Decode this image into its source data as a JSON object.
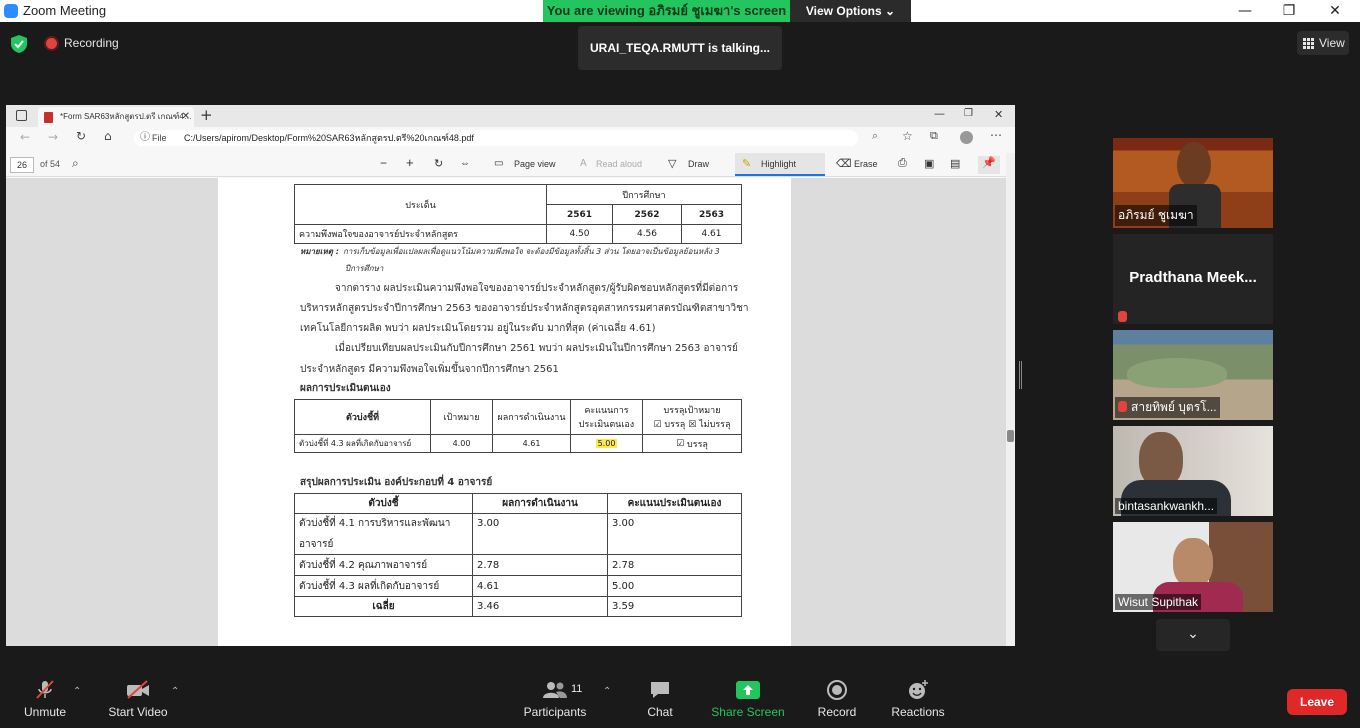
{
  "window": {
    "title": "Zoom Meeting",
    "minimize": "—",
    "maximize": "❐",
    "close": "✕"
  },
  "banner": {
    "viewing": "You are viewing อภิรมย์ ชูเมฆา's screen",
    "view_options": "View Options"
  },
  "status": {
    "recording": "Recording",
    "talking": "URAI_TEQA.RMUTT is talking...",
    "view_button": "View"
  },
  "browser": {
    "tab_title": "*Form SAR63หลักสูตรป.ตรี เกณฑ์4…",
    "file_label": "File",
    "url": "C:/Users/apirom/Desktop/Form%20SAR63หลักสูตรป.ตรี%20เกณฑ์48.pdf",
    "page_current": "26",
    "page_total": "of 54",
    "toolbar": {
      "page_view": "Page view",
      "read_aloud": "Read aloud",
      "draw": "Draw",
      "highlight": "Highlight",
      "erase": "Erase"
    }
  },
  "pdf": {
    "table1": {
      "h_topic": "ประเด็น",
      "h_year": "ปีการศึกษา",
      "years": [
        "2561",
        "2562",
        "2563"
      ],
      "row_label": "ความพึงพอใจของอาจารย์ประจำหลักสูตร",
      "values": [
        "4.50",
        "4.56",
        "4.61"
      ]
    },
    "note_label": "หมายเหตุ :",
    "note_line1": "การเก็บข้อมูลเพื่อแปลผลเพื่อดูแนวโน้มความพึงพอใจ จะต้องมีข้อมูลทั้งสิ้น 3 ส่วน โดยอาจเป็นข้อมูลย้อนหลัง 3",
    "note_line2": "ปีการศึกษา",
    "para1_l1": "จากตาราง ผลประเมินความพึงพอใจของอาจารย์ประจำหลักสูตร/ผู้รับผิดชอบหลักสูตรที่มีต่อการ",
    "para1_l2": "บริหารหลักสูตรประจำปีการศึกษา 2563 ของอาจารย์ประจำหลักสูตรอุตสาหกรรมศาสตรบัณฑิตสาขาวิชา",
    "para1_l3": "เทคโนโลยีการผลิต พบว่า ผลประเมินโดยรวม อยู่ในระดับ มากที่สุด (ค่าเฉลี่ย 4.61)",
    "para2_l1": "เมื่อเปรียบเทียบผลประเมินกับปีการศึกษา 2561 พบว่า ผลประเมินในปีการศึกษา 2563 อาจารย์",
    "para2_l2": "ประจำหลักสูตร มีความพึงพอใจเพิ่มขึ้นจากปีการศึกษา 2561",
    "self_eval_heading": "ผลการประเมินตนเอง",
    "table2": {
      "h_indicator": "ตัวบ่งชี้ที่",
      "h_target": "เป้าหมาย",
      "h_result": "ผลการดำเนินงาน",
      "h_score_l1": "คะแนนการ",
      "h_score_l2": "ประเมินตนเอง",
      "h_achieve": "บรรลุเป้าหมาย",
      "h_yes": "บรรลุ",
      "h_no": "ไม่บรรลุ",
      "row_indicator": "ตัวบ่งชี้ที่ 4.3 ผลที่เกิดกับอาจารย์",
      "row_target": "4.00",
      "row_result": "4.61",
      "row_score": "5.00",
      "row_achieve": "บรรลุ"
    },
    "summary_heading": "สรุปผลการประเมิน องค์ประกอบที่ 4 อาจารย์",
    "table3": {
      "h_indicator": "ตัวบ่งชี้",
      "h_result": "ผลการดำเนินงาน",
      "h_score": "คะแนนประเมินตนเอง",
      "r1_l1": "ตัวบ่งชี้ที่ 4.1 การบริหารและพัฒนา",
      "r1_l2": "อาจารย์",
      "r1_result": "3.00",
      "r1_score": "3.00",
      "r2_label": "ตัวบ่งชี้ที่ 4.2 คุณภาพอาจารย์",
      "r2_result": "2.78",
      "r2_score": "2.78",
      "r3_label": "ตัวบ่งชี้ที่ 4.3 ผลที่เกิดกับอาจารย์",
      "r3_result": "4.61",
      "r3_score": "5.00",
      "avg_label": "เฉลี่ย",
      "avg_result": "3.46",
      "avg_score": "3.59"
    }
  },
  "participants_panel": [
    {
      "name": "อภิรมย์ ชูเมฆา"
    },
    {
      "name": "Pradthana Meek..."
    },
    {
      "name": "สายทิพย์ บุตรโ..."
    },
    {
      "name": "bintasankwankh..."
    },
    {
      "name": "Wisut Supithak"
    }
  ],
  "toolbar": {
    "unmute": "Unmute",
    "start_video": "Start Video",
    "participants": "Participants",
    "participants_count": "11",
    "chat": "Chat",
    "share_screen": "Share Screen",
    "record": "Record",
    "reactions": "Reactions",
    "leave": "Leave"
  },
  "colors": {
    "zoom_green": "#23c55e",
    "leave_red": "#e02828",
    "share_green": "#23c55e"
  }
}
